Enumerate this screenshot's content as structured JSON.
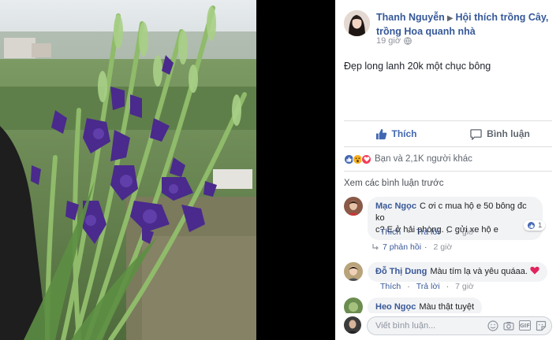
{
  "post": {
    "author": "Thanh Nguyễn",
    "arrow": "▶",
    "group": "Hội thích trồng Cây, trồng Hoa quanh nhà",
    "time": "19 giờ",
    "text": "Đẹp long lanh 20k một chục bông"
  },
  "actions": {
    "like_label": "Thích",
    "comment_label": "Bình luận"
  },
  "reactions": {
    "summary": "Bạn và 2,1K người khác",
    "icons": [
      "like-icon",
      "wow-icon",
      "love-icon"
    ]
  },
  "comments": {
    "view_previous": "Xem các bình luận trước",
    "items": [
      {
        "name": "Mạc Ngọc",
        "text_line1": "C ơi c mua hộ e 50 bông đc ko",
        "text_line2": "c? E ở hải phòng. C gửi xe hộ e",
        "like_label": "Thích",
        "reply_label": "Trả lời",
        "time": "7 giờ",
        "reaction_count": "1",
        "replies_label": "7 phản hồi",
        "replies_time": "2 giờ"
      },
      {
        "name": "Đỗ Thị Dung",
        "text": "Màu tím lạ và yêu quáaa.",
        "like_label": "Thích",
        "reply_label": "Trả lời",
        "time": "7 giờ"
      },
      {
        "name": "Heo Ngọc",
        "text": "Màu thật tuyệt"
      }
    ]
  },
  "composer": {
    "placeholder": "Viết bình luận..."
  },
  "colors": {
    "link": "#365899",
    "like_blue": "#4267b2",
    "bubble_bg": "#f2f3f5",
    "flower_purple": "#4a2a8c"
  }
}
